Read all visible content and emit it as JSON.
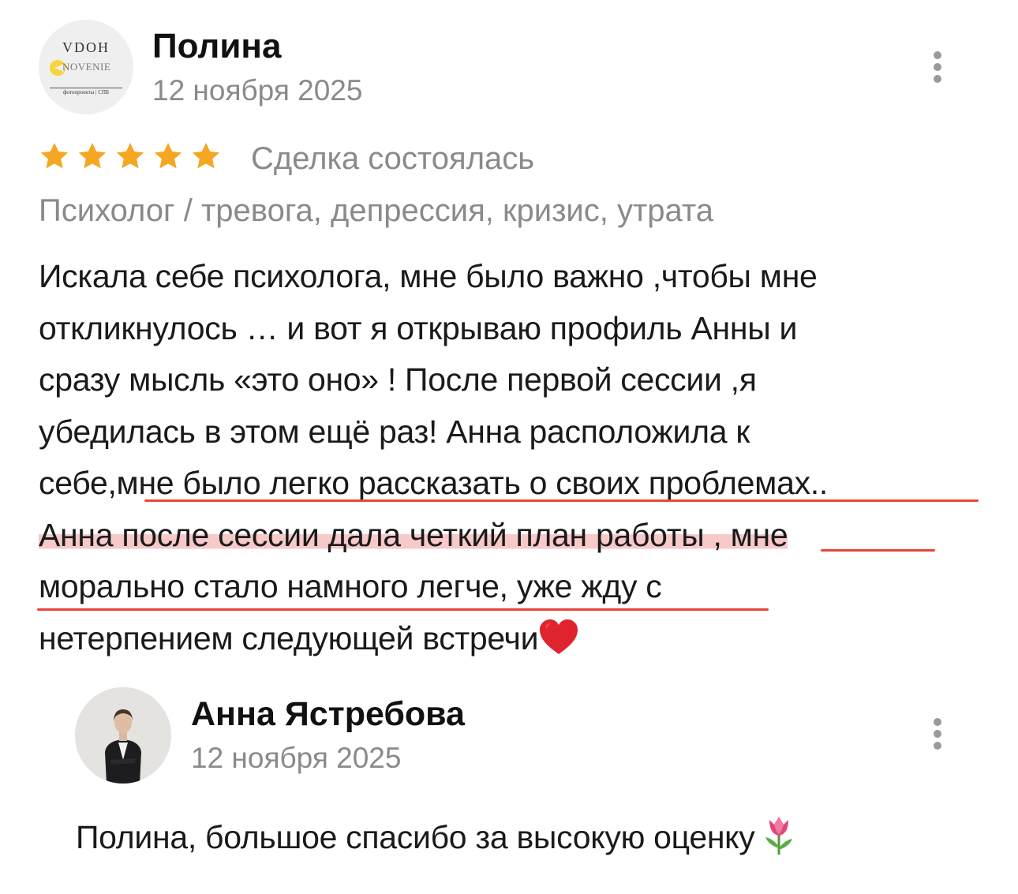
{
  "review": {
    "author": {
      "name": "Полина",
      "date": "12 ноября 2025",
      "avatar": {
        "logo_top": "VDOH",
        "logo_mid": "NOVENIE",
        "logo_bottom": "фотопроекты | СПБ"
      }
    },
    "rating": 5,
    "status": "Сделка состоялась",
    "category": "Психолог / тревога, депрессия, кризис, утрата",
    "text_lines": [
      "Искала себе психолога, мне было важно ,чтобы мне",
      "откликнулось … и вот я открываю профиль Анны и",
      "сразу мысль «это оно» ! После первой сессии ,я",
      "убедилась в этом ещё раз! Анна расположила к",
      "себе,мне было легко рассказать о своих проблемах..",
      "Анна после сессии дала четкий план работы , мне",
      "морально стало намного легче, уже жду с",
      "нетерпением следующей встречи"
    ],
    "emoji": "heart-icon",
    "menu_icon": "more-vertical-icon"
  },
  "reply": {
    "author": {
      "name": "Анна Ястребова",
      "date": "12 ноября 2025"
    },
    "text": "Полина, большое спасибо за высокую оценку",
    "emoji": "tulip-icon",
    "menu_icon": "more-vertical-icon"
  },
  "colors": {
    "star": "#f5a623",
    "secondary_text": "#8a8a8a",
    "underline": "#e8453c",
    "highlight": "#f7c9c9"
  }
}
